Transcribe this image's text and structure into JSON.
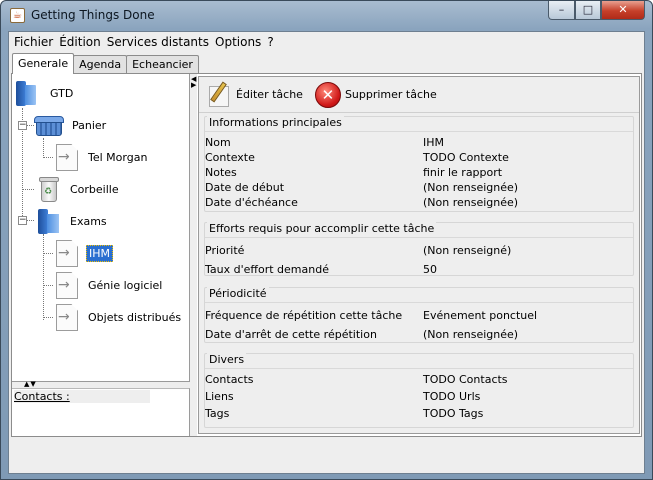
{
  "window": {
    "title": "Getting Things Done",
    "icon": "java-icon",
    "controls": {
      "minimize": "–",
      "maximize": "□",
      "close": "✕"
    }
  },
  "menu": [
    "Fichier",
    "Édition",
    "Services distants",
    "Options",
    "?"
  ],
  "tabs": [
    {
      "label": "Generale",
      "active": true
    },
    {
      "label": "Agenda",
      "active": false
    },
    {
      "label": "Echeancier",
      "active": false
    }
  ],
  "tree": {
    "root": "GTD",
    "panier": "Panier",
    "tel_morgan": "Tel Morgan",
    "corbeille": "Corbeille",
    "exams": "Exams",
    "ihm": "IHM",
    "genie": "Génie logiciel",
    "objets": "Objets distribués",
    "expanded_symbol": "−"
  },
  "contacts_label": "Contacts :",
  "toolbar": {
    "edit_label": "Éditer tâche",
    "delete_label": "Supprimer tâche"
  },
  "sections": {
    "info": {
      "title": "Informations principales",
      "rows": [
        {
          "k": "Nom",
          "v": "IHM"
        },
        {
          "k": "Contexte",
          "v": "TODO Contexte"
        },
        {
          "k": "Notes",
          "v": "finir le rapport"
        },
        {
          "k": "Date de début",
          "v": "(Non renseignée)"
        },
        {
          "k": "Date d'échéance",
          "v": "(Non renseignée)"
        }
      ]
    },
    "efforts": {
      "title": "Efforts requis pour accomplir cette tâche",
      "rows": [
        {
          "k": "Priorité",
          "v": "(Non renseigné)"
        },
        {
          "k": "Taux d'effort demandé",
          "v": "50"
        }
      ]
    },
    "periodicite": {
      "title": "Périodicité",
      "rows": [
        {
          "k": "Fréquence de répétition cette tâche",
          "v": "Evénement ponctuel"
        },
        {
          "k": "Date d'arrêt de cette répétition",
          "v": "(Non renseignée)"
        }
      ]
    },
    "divers": {
      "title": "Divers",
      "rows": [
        {
          "k": "Contacts",
          "v": "TODO Contacts"
        },
        {
          "k": "Liens",
          "v": "TODO Urls"
        },
        {
          "k": "Tags",
          "v": "TODO Tags"
        }
      ]
    }
  }
}
